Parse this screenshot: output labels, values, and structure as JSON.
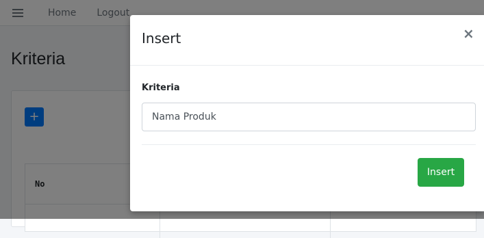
{
  "navbar": {
    "menu_icon": "hamburger-icon",
    "home_label": "Home",
    "logout_label": "Logout"
  },
  "page": {
    "title": "Kriteria",
    "add_button_label": "+",
    "table": {
      "headers": [
        "No"
      ]
    }
  },
  "modal": {
    "title": "Insert",
    "close_label": "×",
    "field_label": "Kriteria",
    "field_value": "Nama Produk",
    "submit_label": "Insert"
  },
  "colors": {
    "primary": "#007bff",
    "success": "#28a745",
    "overlay": "rgba(0,0,0,0.5)"
  }
}
